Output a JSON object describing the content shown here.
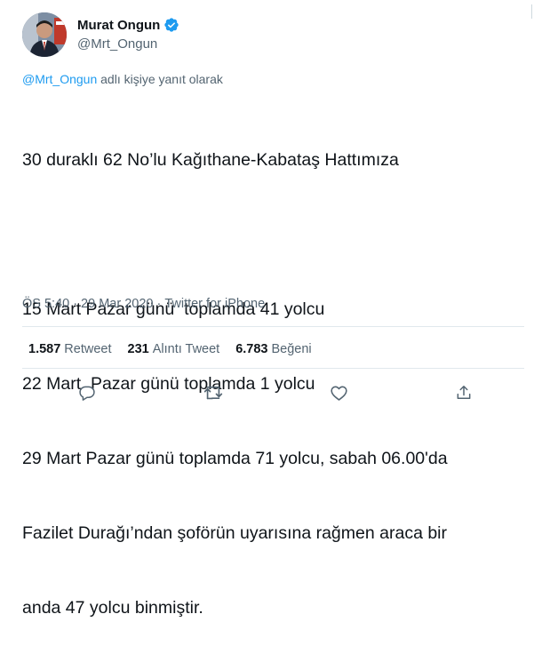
{
  "author": {
    "name": "Murat Ongun",
    "handle": "@Mrt_Ongun"
  },
  "reply_context": {
    "mention": "@Mrt_Ongun",
    "suffix": "adlı kişiye yanıt olarak"
  },
  "tweet": {
    "lines": [
      "30 duraklı 62 No’lu Kağıthane-Kabataş Hattımıza",
      "",
      "15 Mart Pazar günü  toplamda 41 yolcu",
      "22 Mart  Pazar günü toplamda 1 yolcu",
      "29 Mart Pazar günü toplamda 71 yolcu, sabah 06.00'da",
      "Fazilet Durağı’ndan şoförün uyarısına rağmen araca bir",
      "anda 47 yolcu binmiştir."
    ],
    "time": "ÖS 5:40",
    "separator": "·",
    "date": "29 Mar 2020",
    "source": "Twitter for iPhone"
  },
  "stats": {
    "retweets": {
      "count": "1.587",
      "label": "Retweet"
    },
    "quotes": {
      "count": "231",
      "label": "Alıntı Tweet"
    },
    "likes": {
      "count": "6.783",
      "label": "Beğeni"
    }
  },
  "icons": {
    "reply": "reply-icon",
    "retweet": "retweet-icon",
    "like": "heart-icon",
    "share": "share-icon",
    "verified": "verified-badge-icon"
  },
  "colors": {
    "accent": "#1d9bf0",
    "secondary_text": "#536471",
    "primary_text": "#0f1419"
  }
}
